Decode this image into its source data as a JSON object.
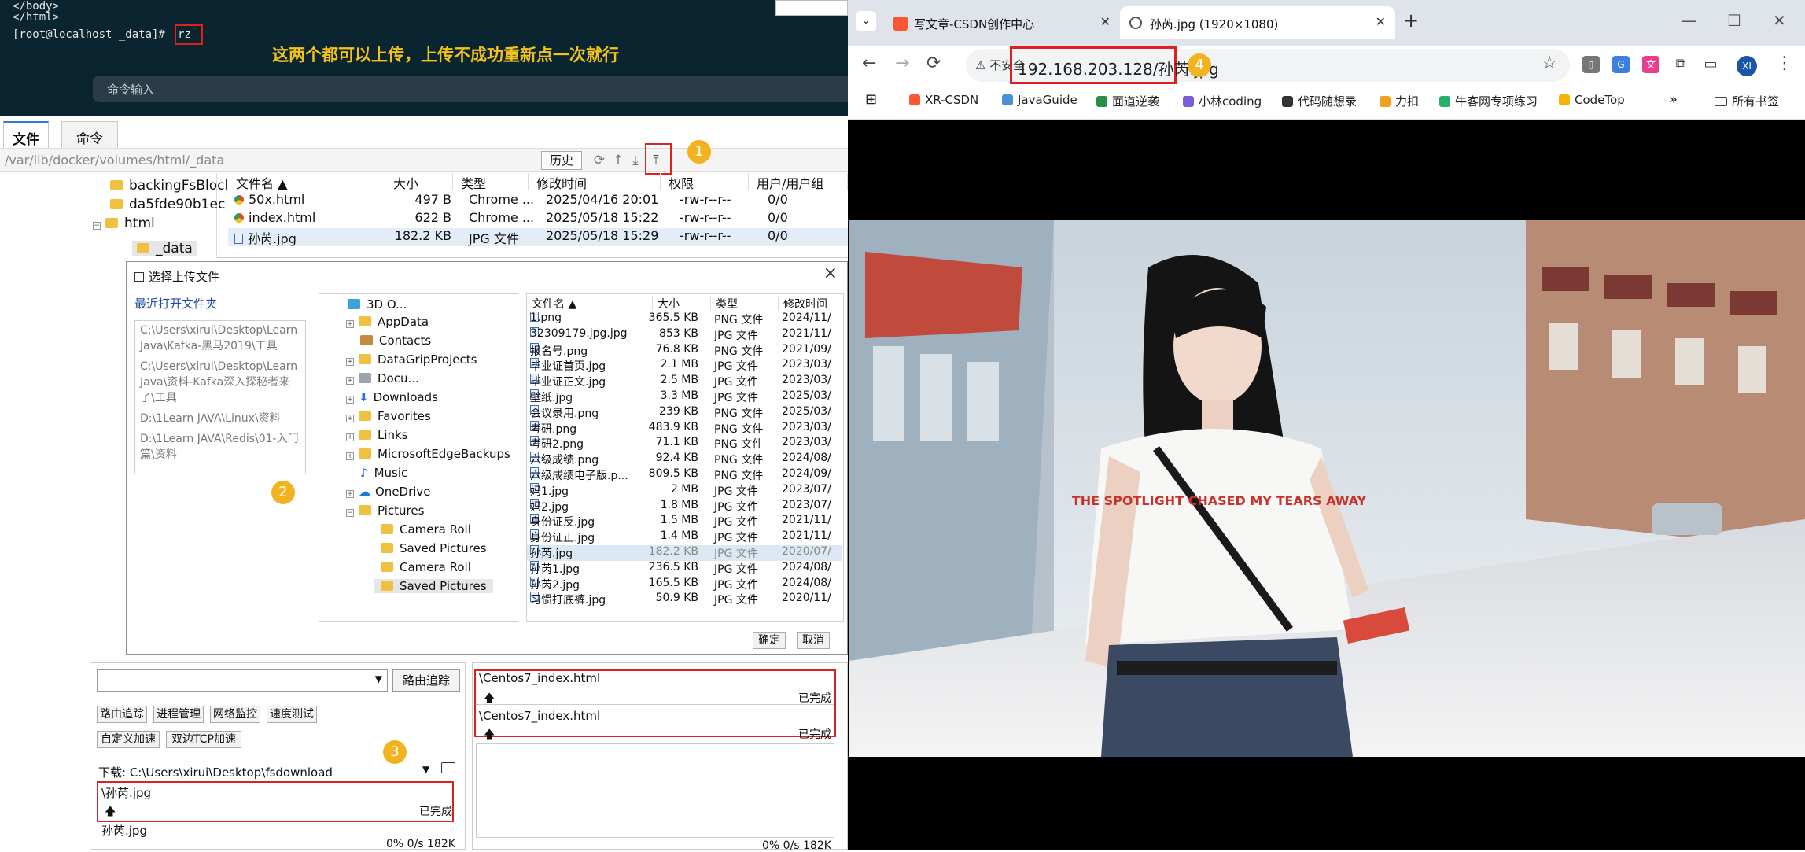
{
  "terminal": {
    "line1": "</body>",
    "line2": "</html>",
    "prompt": "[root@localhost _data]# ",
    "command": "rz",
    "note": "这两个都可以上传，上传不成功重新点一次就行",
    "cmd_input_placeholder": "命令输入"
  },
  "file_panel": {
    "tabs": [
      "文件",
      "命令"
    ],
    "path": "/var/lib/docker/volumes/html/_data",
    "history_label": "历史",
    "badge1": "1",
    "tree": [
      "backingFsBlocl",
      "da5fde90b1ec",
      "html",
      "_data"
    ],
    "columns": [
      "文件名",
      "大小",
      "类型",
      "修改时间",
      "权限",
      "用户/用户组"
    ],
    "rows": [
      {
        "name": "50x.html",
        "size": "497 B",
        "type": "Chrome ...",
        "mtime": "2025/04/16 20:01",
        "perm": "-rw-r--r--",
        "owner": "0/0"
      },
      {
        "name": "index.html",
        "size": "622 B",
        "type": "Chrome ...",
        "mtime": "2025/05/18 15:22",
        "perm": "-rw-r--r--",
        "owner": "0/0"
      },
      {
        "name": "孙芮.jpg",
        "size": "182.2 KB",
        "type": "JPG 文件",
        "mtime": "2025/05/18 15:29",
        "perm": "-rw-r--r--",
        "owner": "0/0"
      }
    ]
  },
  "dialog": {
    "title": "选择上传文件",
    "recent_label": "最近打开文件夹",
    "recent": [
      "C:\\Users\\xirui\\Desktop\\Learn Java\\Kafka-黑马2019\\工具",
      "C:\\Users\\xirui\\Desktop\\Learn Java\\资料-Kafka深入探秘者来了\\工具",
      "D:\\1Learn JAVA\\Linux\\资料",
      "D:\\1Learn JAVA\\Redis\\01-入门篇\\资料"
    ],
    "badge2": "2",
    "tree": [
      "3D O...",
      "AppData",
      "Contacts",
      "DataGripProjects",
      "Docu...",
      "Downloads",
      "Favorites",
      "Links",
      "MicrosoftEdgeBackups",
      "Music",
      "OneDrive",
      "Pictures",
      "Camera Roll",
      "Saved Pictures",
      "Camera Roll",
      "Saved Pictures"
    ],
    "columns": [
      "文件名",
      "大小",
      "类型",
      "修改时间"
    ],
    "files": [
      {
        "name": "1.png",
        "size": "365.5 KB",
        "type": "PNG 文件",
        "mtime": "2024/11/"
      },
      {
        "name": "32309179.jpg.jpg",
        "size": "853 KB",
        "type": "JPG 文件",
        "mtime": "2021/11/"
      },
      {
        "name": "报名号.png",
        "size": "76.8 KB",
        "type": "PNG 文件",
        "mtime": "2021/09/"
      },
      {
        "name": "毕业证首页.jpg",
        "size": "2.1 MB",
        "type": "JPG 文件",
        "mtime": "2023/03/"
      },
      {
        "name": "毕业证正文.jpg",
        "size": "2.5 MB",
        "type": "JPG 文件",
        "mtime": "2023/03/"
      },
      {
        "name": "壁纸.jpg",
        "size": "3.3 MB",
        "type": "JPG 文件",
        "mtime": "2025/03/"
      },
      {
        "name": "会议录用.png",
        "size": "239 KB",
        "type": "PNG 文件",
        "mtime": "2025/03/"
      },
      {
        "name": "考研.png",
        "size": "483.9 KB",
        "type": "PNG 文件",
        "mtime": "2023/03/"
      },
      {
        "name": "考研2.png",
        "size": "71.1 KB",
        "type": "PNG 文件",
        "mtime": "2023/03/"
      },
      {
        "name": "六级成绩.png",
        "size": "92.4 KB",
        "type": "PNG 文件",
        "mtime": "2024/08/"
      },
      {
        "name": "六级成绩电子版.p...",
        "size": "809.5 KB",
        "type": "PNG 文件",
        "mtime": "2024/09/"
      },
      {
        "name": "妈1.jpg",
        "size": "2 MB",
        "type": "JPG 文件",
        "mtime": "2023/07/"
      },
      {
        "name": "妈2.jpg",
        "size": "1.8 MB",
        "type": "JPG 文件",
        "mtime": "2023/07/"
      },
      {
        "name": "身份证反.jpg",
        "size": "1.5 MB",
        "type": "JPG 文件",
        "mtime": "2021/11/"
      },
      {
        "name": "身份证正.jpg",
        "size": "1.4 MB",
        "type": "JPG 文件",
        "mtime": "2021/11/"
      },
      {
        "name": "孙芮.jpg",
        "size": "182.2 KB",
        "type": "JPG 文件",
        "mtime": "2020/07/"
      },
      {
        "name": "孙芮1.jpg",
        "size": "236.5 KB",
        "type": "JPG 文件",
        "mtime": "2024/08/"
      },
      {
        "name": "孙芮2.jpg",
        "size": "165.5 KB",
        "type": "JPG 文件",
        "mtime": "2024/08/"
      },
      {
        "name": "习惯打底裤.jpg",
        "size": "50.9 KB",
        "type": "JPG 文件",
        "mtime": "2020/11/"
      }
    ],
    "ok_label": "确定",
    "cancel_label": "取消"
  },
  "transfer_left": {
    "route_btn": "路由追踪",
    "tools": [
      "路由追踪",
      "进程管理",
      "网络监控",
      "速度测试",
      "自定义加速",
      "双边TCP加速"
    ],
    "download_path": "下载: C:\\Users\\xirui\\Desktop\\fsdownload",
    "badge3": "3",
    "item1_name": "\\孙芮.jpg",
    "item1_status": "已完成",
    "item2_name": "孙芮.jpg",
    "item2_status": "0% 0/s 182K"
  },
  "transfer_mid": {
    "item1_name": "\\Centos7_index.html",
    "item1_status": "已完成",
    "item2_name": "\\Centos7_index.html",
    "item2_status": "已完成",
    "item3_status": "0% 0/s 182K"
  },
  "browser": {
    "tab1_title": "写文章-CSDN创作中心",
    "tab2_title": "孙芮.jpg (1920×1080)",
    "insecure_label": "不安全",
    "url": "192.168.203.128/孙芮.jpg",
    "badge4": "4",
    "profile_initials": "XI",
    "bookmarks": [
      "XR-CSDN",
      "JavaGuide",
      "面道逆袭",
      "小林coding",
      "代码随想录",
      "力扣",
      "牛客网专项练习",
      "CodeTop"
    ],
    "all_bookmarks": "所有书签",
    "shirt_text": "THE SPOTLIGHT CHASED MY TEARS AWAY"
  },
  "colors": {
    "highlight_red": "#e02020",
    "badge_yellow": "#f2b320",
    "terminal_bg": "#0b2530",
    "note_yellow": "#f2c21b"
  }
}
